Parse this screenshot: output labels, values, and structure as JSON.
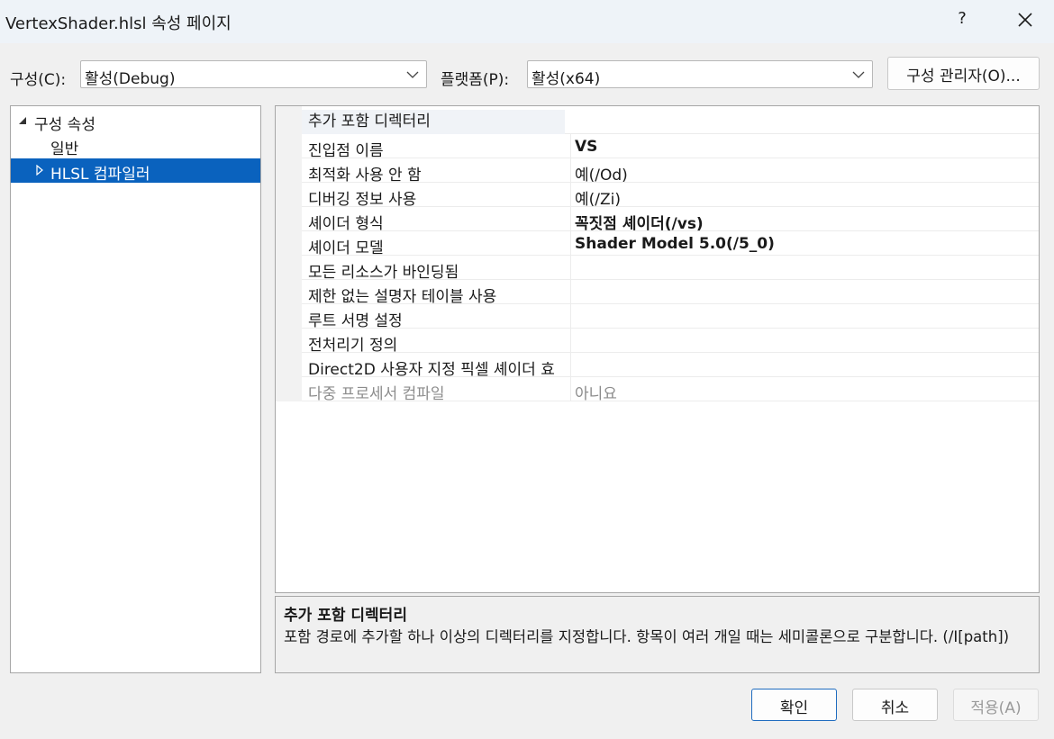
{
  "window": {
    "title": "VertexShader.hlsl 속성 페이지",
    "help": "?"
  },
  "toolbar": {
    "config_label": "구성(C):",
    "config_value": "활성(Debug)",
    "platform_label": "플랫폼(P):",
    "platform_value": "활성(x64)",
    "config_manager_label": "구성 관리자(O)..."
  },
  "tree": {
    "root": "구성 속성",
    "items": [
      {
        "label": "일반"
      },
      {
        "label": "HLSL 컴파일러"
      }
    ]
  },
  "properties": [
    {
      "name": "추가 포함 디렉터리",
      "value": ""
    },
    {
      "name": "진입점 이름",
      "value": "VS"
    },
    {
      "name": "최적화 사용 안 함",
      "value": "예(/Od)"
    },
    {
      "name": "디버깅 정보 사용",
      "value": "예(/Zi)"
    },
    {
      "name": "셰이더 형식",
      "value": "꼭짓점 셰이더(/vs)"
    },
    {
      "name": "셰이더 모델",
      "value": "Shader Model 5.0(/5_0)"
    },
    {
      "name": "모든 리소스가 바인딩됨",
      "value": ""
    },
    {
      "name": "제한 없는 설명자 테이블 사용",
      "value": ""
    },
    {
      "name": "루트 서명 설정",
      "value": ""
    },
    {
      "name": "전처리기 정의",
      "value": ""
    },
    {
      "name": "Direct2D 사용자 지정 픽셀 셰이더 효",
      "value": ""
    },
    {
      "name": "다중 프로세서 컴파일",
      "value": "아니요"
    }
  ],
  "description": {
    "title": "추가 포함 디렉터리",
    "text": "포함 경로에 추가할 하나 이상의 디렉터리를 지정합니다. 항목이 여러 개일 때는 세미콜론으로 구분합니다. (/I[path])"
  },
  "buttons": {
    "ok": "확인",
    "cancel": "취소",
    "apply": "적용(A)"
  }
}
